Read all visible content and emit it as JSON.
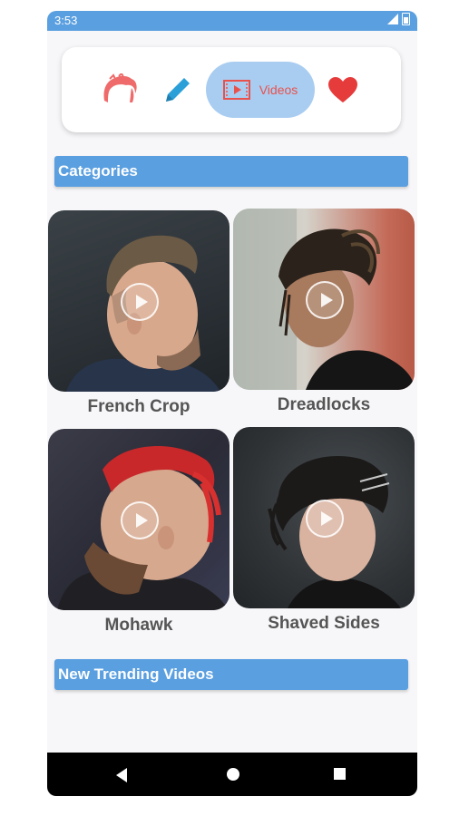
{
  "status_bar": {
    "time": "3:53"
  },
  "nav": {
    "items": [
      {
        "icon": "hair-icon"
      },
      {
        "icon": "pencil-icon"
      },
      {
        "icon": "video-icon",
        "label": "Videos"
      },
      {
        "icon": "heart-icon"
      }
    ],
    "accent": "#e9514c",
    "active_bg": "#a9cdf1"
  },
  "sections": {
    "categories": "Categories",
    "trending": "New Trending Videos"
  },
  "categories": [
    {
      "label": "French Crop"
    },
    {
      "label": "Dreadlocks"
    },
    {
      "label": "Mohawk"
    },
    {
      "label": "Shaved Sides"
    }
  ],
  "colors": {
    "header": "#5a9fe0",
    "status": "#5a9fe0"
  }
}
